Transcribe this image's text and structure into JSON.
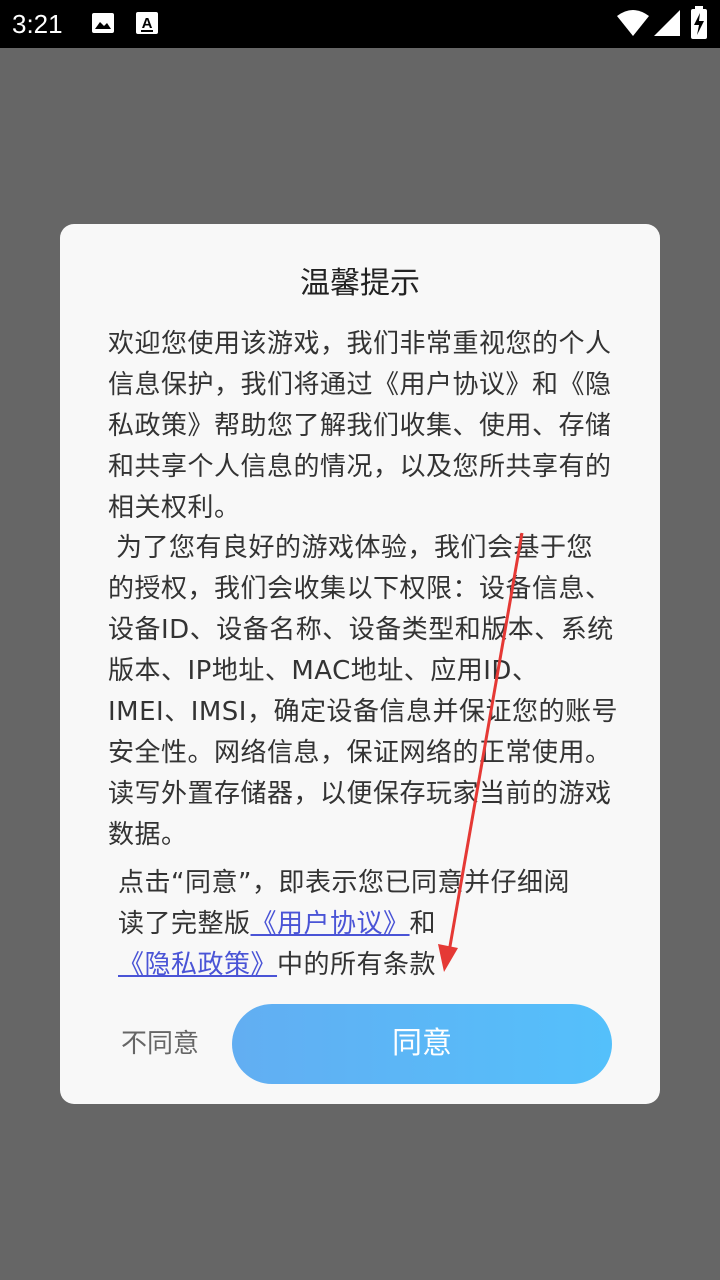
{
  "status_bar": {
    "time": "3:21",
    "icons": [
      "image-icon",
      "font-download-icon",
      "wifi-icon",
      "signal-icon",
      "battery-charging-icon"
    ]
  },
  "dialog": {
    "title": "温馨提示",
    "paragraph1": "欢迎您使用该游戏，我们非常重视您的个人信息保护，我们将通过《用户协议》和《隐私政策》帮助您了解我们收集、使用、存储和共享个人信息的情况，以及您所共享有的相关权利。",
    "paragraph2": "为了您有良好的游戏体验，我们会基于您的授权，我们会收集以下权限：设备信息、设备ID、设备名称、设备类型和版本、系统版本、IP地址、MAC地址、应用ID、IMEI、IMSI，确定设备信息并保证您的账号安全性。网络信息，保证网络的正常使用。读写外置存储器，以便保存玩家当前的游戏数据。",
    "consent": {
      "prefix": "点击“同意”，即表示您已同意并仔细阅读了完整版",
      "user_agreement_link": "《用户协议》",
      "and": "和",
      "privacy_policy_link": "《隐私政策》",
      "suffix": "中的所有条款"
    },
    "disagree_label": "不同意",
    "agree_label": "同意"
  },
  "colors": {
    "overlay": "#666666",
    "dialog_bg": "#f8f8f8",
    "link": "#4a54d6",
    "agree_button": "#5bb7f6",
    "annotation_arrow": "#e53935"
  }
}
